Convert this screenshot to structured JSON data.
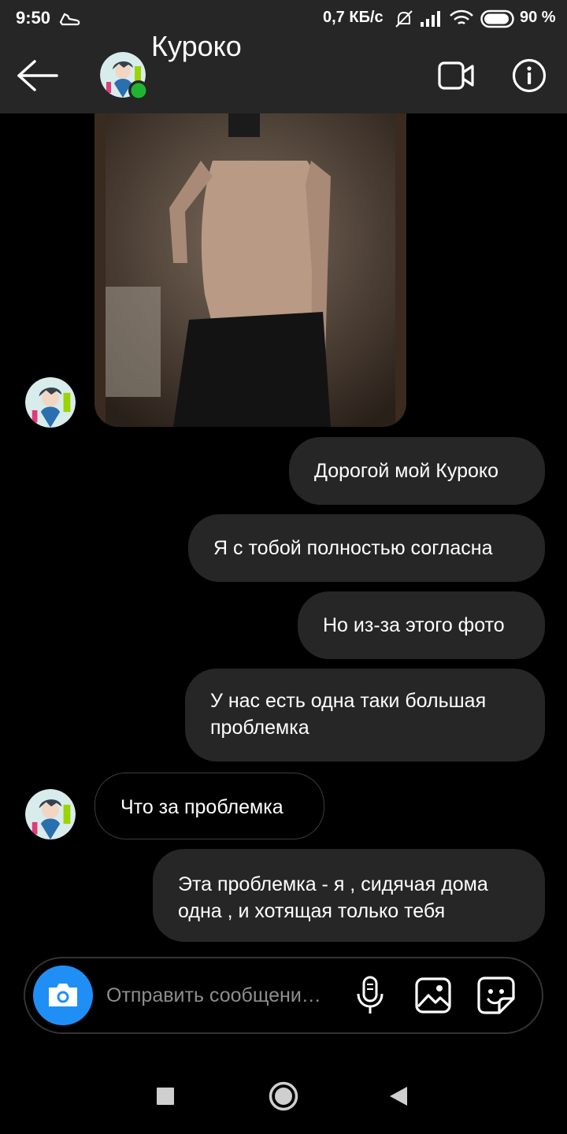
{
  "status_bar": {
    "time": "9:50",
    "network_speed": "0,7 КБ/с",
    "battery_percent": "90 %"
  },
  "header": {
    "title": "Куроко",
    "online": true,
    "online_color": "#20b531"
  },
  "messages": [
    {
      "side": "received",
      "type": "photo",
      "content": "mirror selfie photo"
    },
    {
      "side": "sent",
      "text": "Дорогой мой Куроко"
    },
    {
      "side": "sent",
      "text": "Я с тобой полностью согласна"
    },
    {
      "side": "sent",
      "text": "Но из-за этого фото"
    },
    {
      "side": "sent",
      "text": "У нас есть одна таки большая проблемка"
    },
    {
      "side": "received",
      "text": "Что за проблемка"
    },
    {
      "side": "sent",
      "text": "Эта проблемка - я , сидячая дома одна , и хотящая только тебя"
    }
  ],
  "composer": {
    "placeholder": "Отправить сообщени…",
    "camera_color": "#1f8ff5"
  },
  "icons": {
    "back": "arrow-left-icon",
    "video": "video-camera-icon",
    "info": "info-icon",
    "camera": "camera-icon",
    "mic": "microphone-icon",
    "gallery": "image-gallery-icon",
    "sticker": "sticker-icon"
  }
}
